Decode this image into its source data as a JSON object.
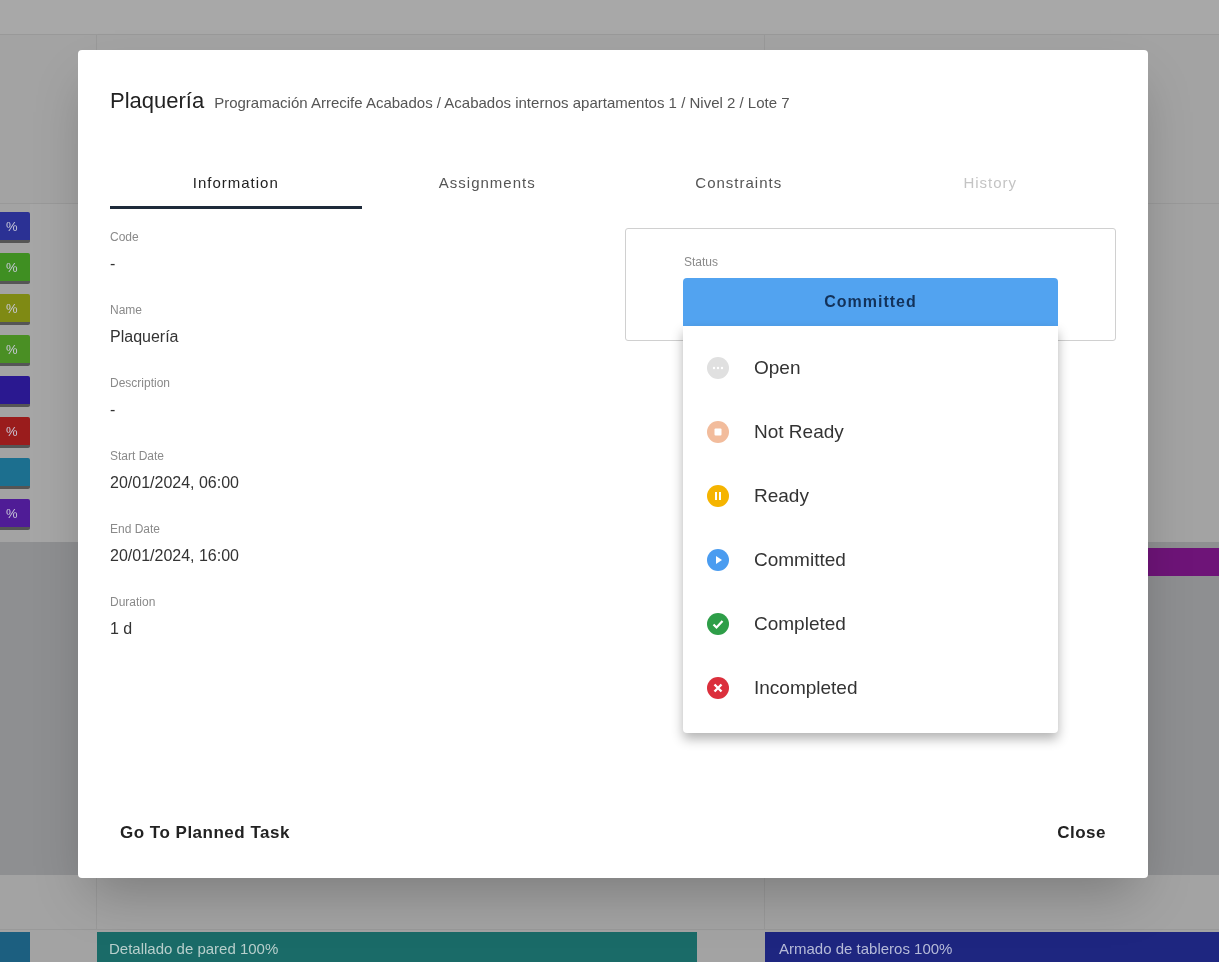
{
  "background": {
    "chips": [
      {
        "label": "%",
        "color": "#2b3194"
      },
      {
        "label": "%",
        "color": "#3f8f22"
      },
      {
        "label": "%",
        "color": "#7f8a14"
      },
      {
        "label": "%",
        "color": "#4a8f24"
      },
      {
        "color": "#2a1890"
      },
      {
        "label": "%",
        "color": "#9a1c1c"
      },
      {
        "color": "#1c6f8f"
      },
      {
        "label": "%",
        "color": "#4f1c96"
      }
    ],
    "side_bar": {
      "color": "#6e1478"
    },
    "bottom_chip": {
      "color": "#1c5f80"
    },
    "bars": [
      {
        "label": "Detallado de pared 100%",
        "color": "#1a6b68"
      },
      {
        "label": "Armado de tableros 100%",
        "color": "#1e2680"
      }
    ]
  },
  "dialog": {
    "title": "Plaquería",
    "breadcrumb": "Programación Arrecife Acabados / Acabados internos apartamentos 1 / Nivel 2 / Lote 7",
    "tabs": [
      {
        "label": "Information",
        "selected": true,
        "disabled": false
      },
      {
        "label": "Assignments",
        "selected": false,
        "disabled": false
      },
      {
        "label": "Constraints",
        "selected": false,
        "disabled": false
      },
      {
        "label": "History",
        "selected": false,
        "disabled": true
      }
    ],
    "fields": [
      {
        "label": "Code",
        "value": "-"
      },
      {
        "label": "Name",
        "value": "Plaquería"
      },
      {
        "label": "Description",
        "value": "-"
      },
      {
        "label": "Start Date",
        "value": "20/01/2024, 06:00"
      },
      {
        "label": "End Date",
        "value": "20/01/2024, 16:00"
      },
      {
        "label": "Duration",
        "value": "1 d"
      }
    ],
    "status": {
      "label": "Status",
      "value": "Committed",
      "color": "#52a3f0",
      "options": [
        {
          "kind": "open",
          "label": "Open",
          "color": "#e0e0e0"
        },
        {
          "kind": "not_ready",
          "label": "Not Ready",
          "color": "#f2bc9c"
        },
        {
          "kind": "ready",
          "label": "Ready",
          "color": "#f5b400"
        },
        {
          "kind": "committed",
          "label": "Committed",
          "color": "#4a9cf0"
        },
        {
          "kind": "completed",
          "label": "Completed",
          "color": "#2e9e48"
        },
        {
          "kind": "incompleted",
          "label": "Incompleted",
          "color": "#db2f3c"
        }
      ]
    },
    "footer": {
      "left_button": "Go To Planned Task",
      "right_button": "Close"
    }
  }
}
